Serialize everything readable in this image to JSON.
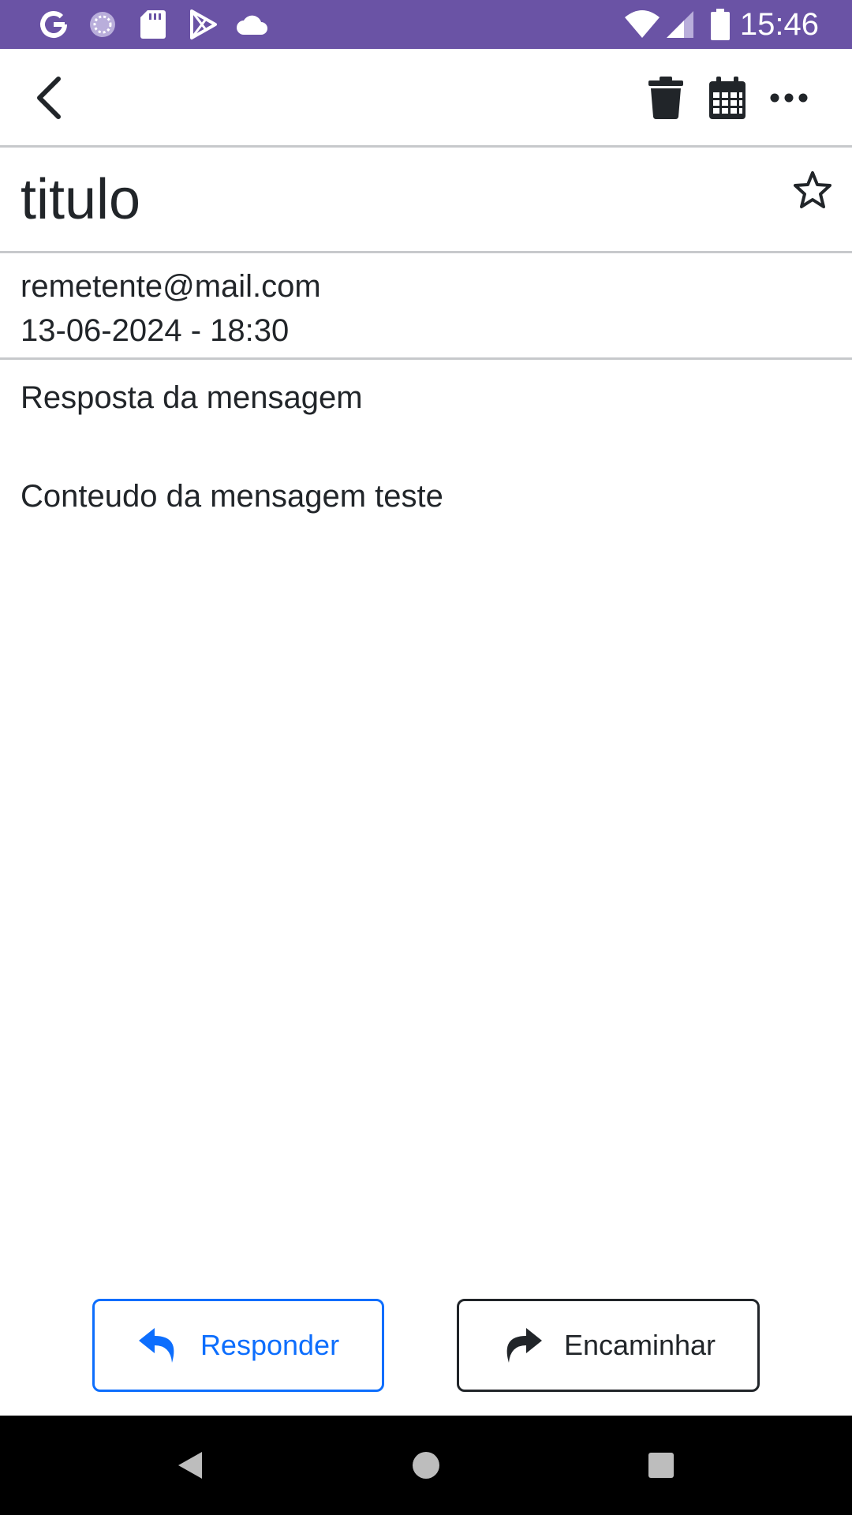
{
  "status_bar": {
    "time": "15:46",
    "icons_left": [
      "google-icon",
      "sync-icon",
      "sd-card-icon",
      "play-store-icon",
      "cloud-icon"
    ],
    "icons_right": [
      "wifi-icon",
      "signal-icon",
      "battery-icon"
    ],
    "color": "#6a53a5"
  },
  "toolbar": {
    "back_icon": "chevron-left-icon",
    "actions": [
      "trash-icon",
      "calendar-icon",
      "more-icon"
    ]
  },
  "message": {
    "subject": "titulo",
    "sender": "remetente@mail.com",
    "date": "13-06-2024 - 18:30",
    "body_lines": [
      "Resposta da mensagem",
      "Conteudo da mensagem teste"
    ]
  },
  "actions": {
    "reply_label": "Responder",
    "forward_label": "Encaminhar",
    "reply_color": "#0d6efd"
  },
  "navigation": [
    "back-triangle-icon",
    "home-circle-icon",
    "recents-square-icon"
  ]
}
